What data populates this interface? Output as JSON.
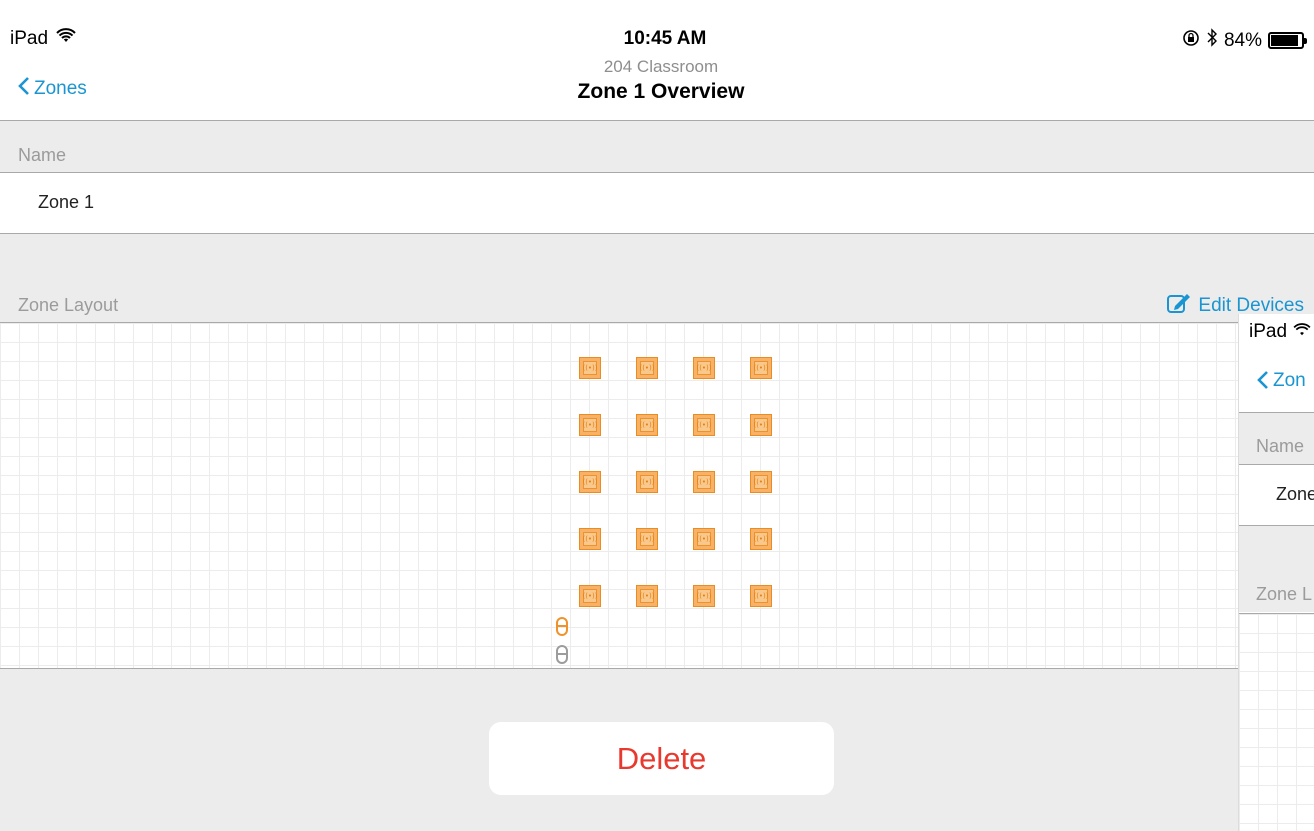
{
  "status_bar": {
    "device": "iPad",
    "time": "10:45 AM",
    "battery": "84%"
  },
  "nav": {
    "back_label": "Zones",
    "subtitle": "204 Classroom",
    "title": "Zone 1 Overview"
  },
  "name_section": {
    "header": "Name",
    "value": "Zone 1"
  },
  "layout_section": {
    "header": "Zone Layout",
    "edit_label": "Edit Devices",
    "devices_rows": 5,
    "devices_cols": 4
  },
  "delete_label": "Delete",
  "overlay": {
    "device": "iPad",
    "back_label": "Zon",
    "name_header": "Name",
    "name_value": "Zone",
    "layout_header": "Zone L"
  },
  "colors": {
    "accent": "#1a95d2",
    "device_fill": "#f7b267",
    "delete_red": "#e8392f"
  },
  "icons": [
    "wifi-icon",
    "chevron-left-icon",
    "rotation-lock-icon",
    "bluetooth-icon",
    "battery-icon",
    "edit-icon",
    "speaker-device-icon",
    "sensor-icon"
  ]
}
